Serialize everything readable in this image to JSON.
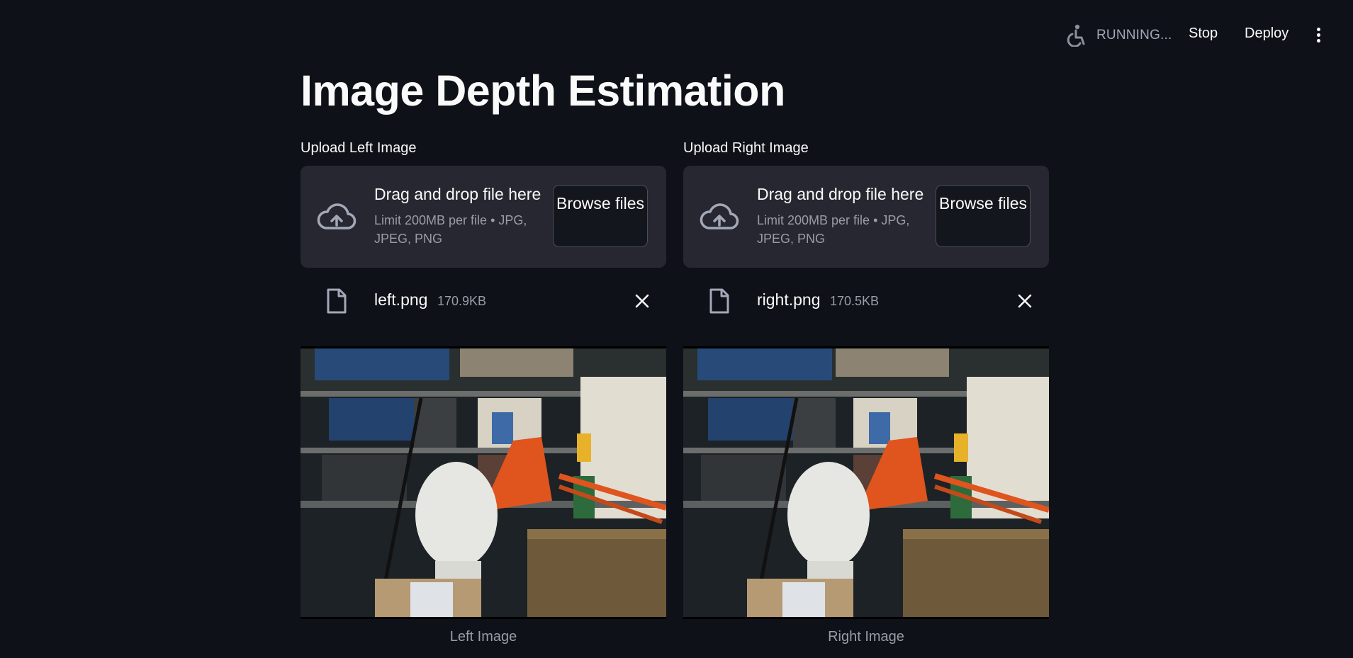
{
  "header": {
    "status_text": "RUNNING...",
    "stop_label": "Stop",
    "deploy_label": "Deploy"
  },
  "page": {
    "title": "Image Depth Estimation"
  },
  "uploaders": [
    {
      "label": "Upload Left Image",
      "drop_title": "Drag and drop file here",
      "drop_limit": "Limit 200MB per file • JPG, JPEG, PNG",
      "browse_label": "Browse files",
      "file_name": "left.png",
      "file_size": "170.9KB",
      "caption": "Left Image"
    },
    {
      "label": "Upload Right Image",
      "drop_title": "Drag and drop file here",
      "drop_limit": "Limit 200MB per file • JPG, JPEG, PNG",
      "browse_label": "Browse files",
      "file_name": "right.png",
      "file_size": "170.5KB",
      "caption": "Right Image"
    }
  ],
  "colors": {
    "background": "#0e1117",
    "dropzone": "#262730",
    "muted_text": "#9a9ca6",
    "lamp_orange": "#e0541e"
  },
  "icons": [
    "accessibility-icon",
    "menu-kebab-icon",
    "cloud-upload-icon",
    "file-icon",
    "close-icon"
  ]
}
